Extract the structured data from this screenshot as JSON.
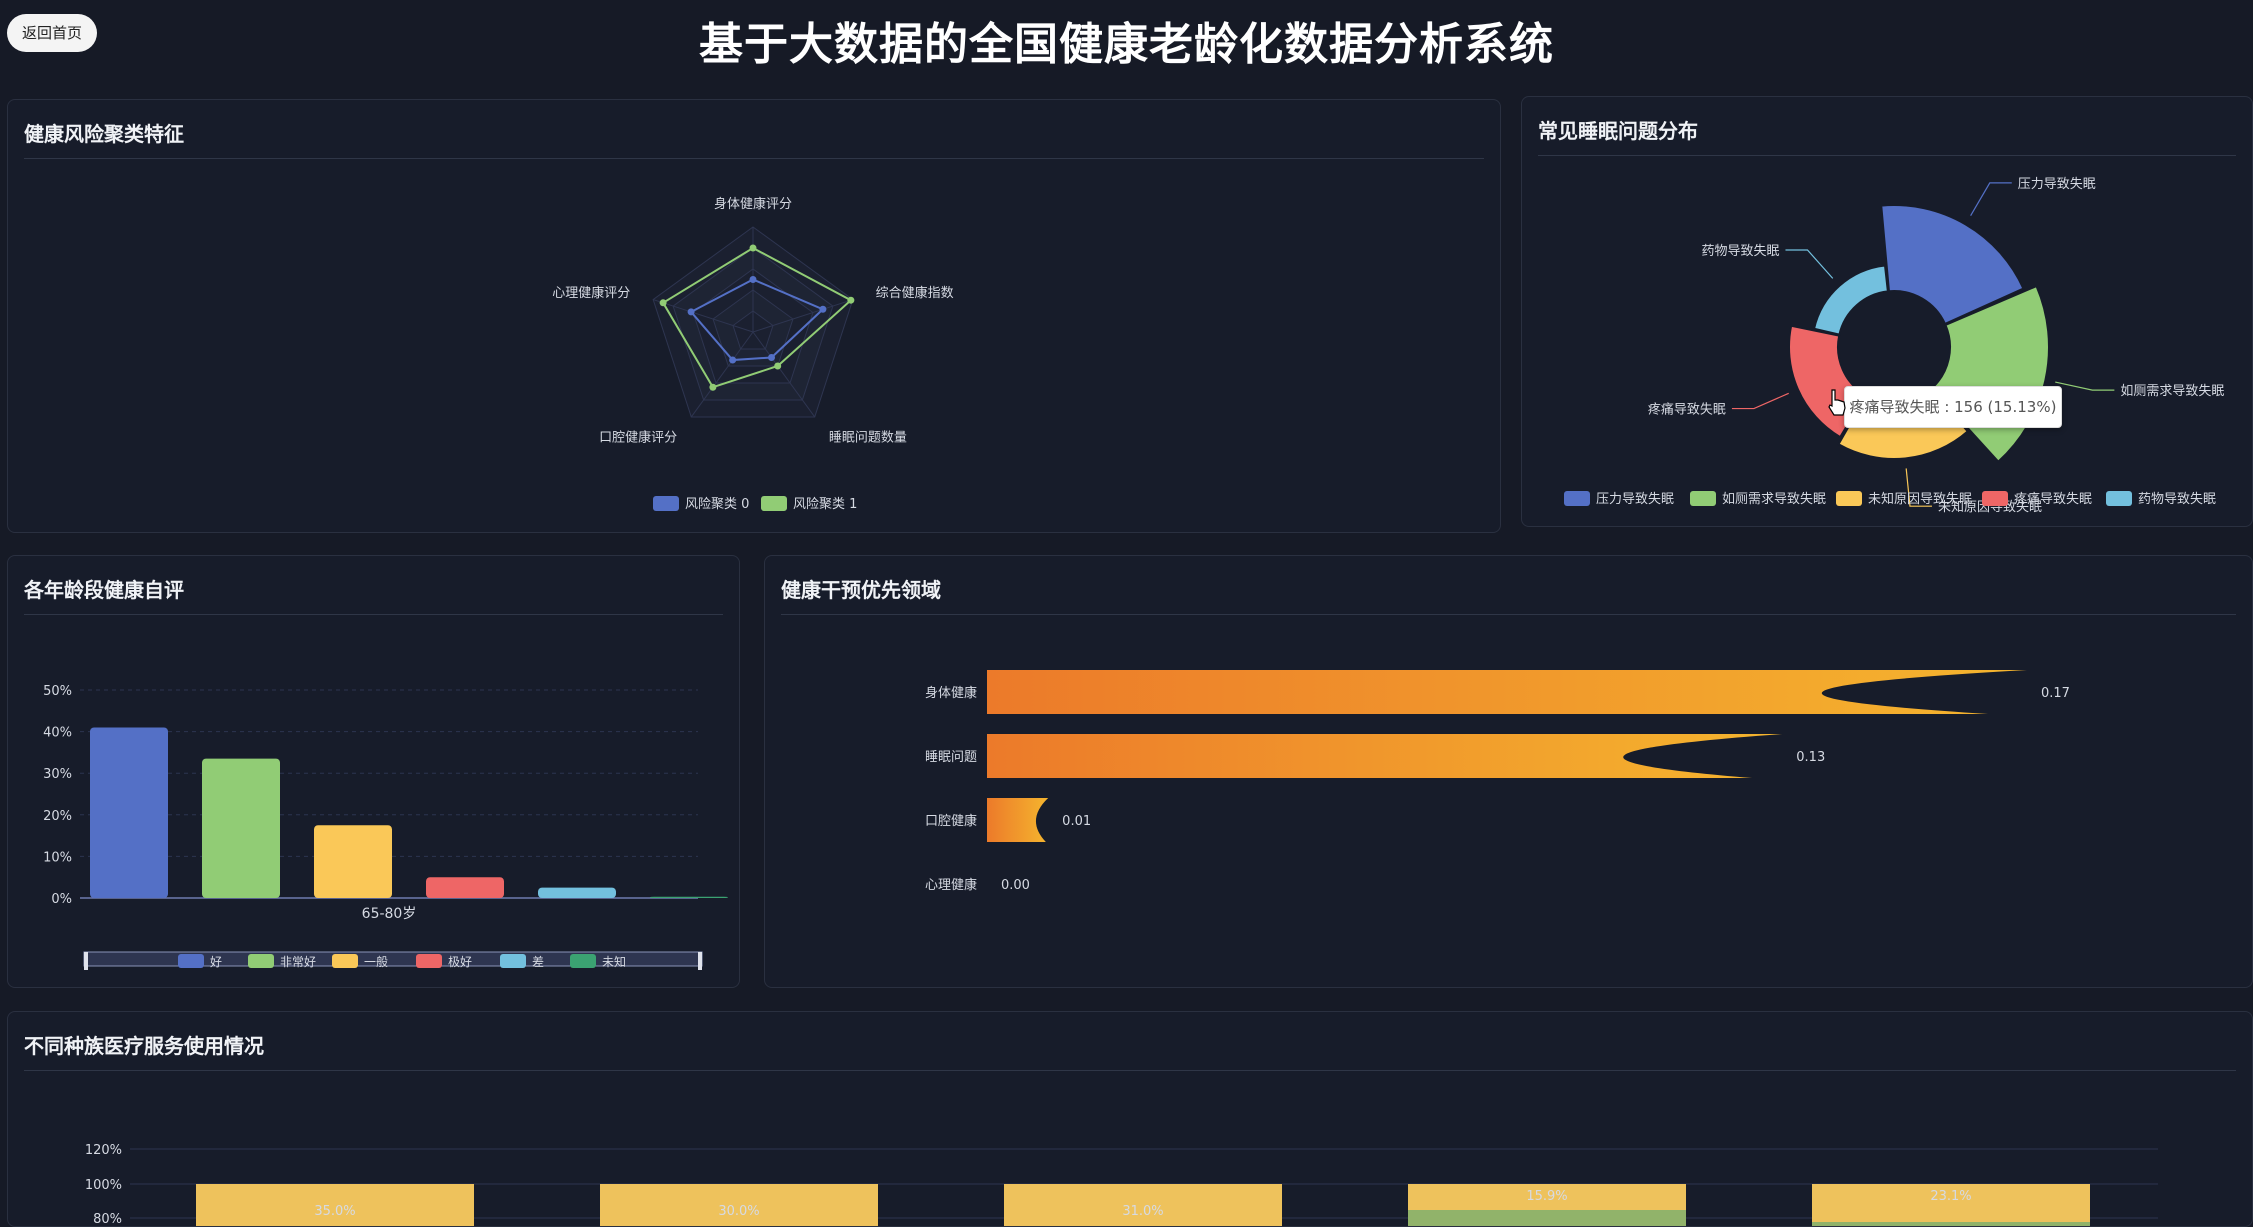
{
  "header": {
    "back_label": "返回首页",
    "title": "基于大数据的全国健康老龄化数据分析系统"
  },
  "panels": {
    "radar_title": "健康风险聚类特征",
    "sleep_title": "常见睡眠问题分布",
    "age_title": "各年龄段健康自评",
    "priority_title": "健康干预优先领域",
    "race_title": "不同种族医疗服务使用情况"
  },
  "tooltip": {
    "text": "疼痛导致失眠 : 156 (15.13%)"
  },
  "chart_data": [
    {
      "type": "radar",
      "indicators": [
        "身体健康评分",
        "综合健康指数",
        "睡眠问题数量",
        "口腔健康评分",
        "心理健康评分"
      ],
      "series": [
        {
          "name": "风险聚类 0",
          "values": [
            0.5,
            0.7,
            0.3,
            0.33,
            0.62
          ],
          "color": "#5470c6"
        },
        {
          "name": "风险聚类 1",
          "values": [
            0.8,
            0.98,
            0.4,
            0.65,
            0.9
          ],
          "color": "#91cc75"
        }
      ],
      "max": 1
    },
    {
      "type": "pie",
      "style": "rose",
      "slices": [
        {
          "name": "压力导致失眠",
          "color": "#5470c6"
        },
        {
          "name": "如厕需求导致失眠",
          "color": "#91cc75"
        },
        {
          "name": "未知原因导致失眠",
          "color": "#fac858"
        },
        {
          "name": "疼痛导致失眠",
          "value": 156,
          "percent": 15.13,
          "color": "#ee6666"
        },
        {
          "name": "药物导致失眠",
          "color": "#73c0de"
        }
      ]
    },
    {
      "type": "bar",
      "categories": [
        "65-80岁"
      ],
      "series": [
        {
          "name": "好",
          "values": [
            41
          ],
          "color": "#5470c6"
        },
        {
          "name": "非常好",
          "values": [
            33.5
          ],
          "color": "#91cc75"
        },
        {
          "name": "一般",
          "values": [
            17.5
          ],
          "color": "#fac858"
        },
        {
          "name": "极好",
          "values": [
            5
          ],
          "color": "#ee6666"
        },
        {
          "name": "差",
          "values": [
            2.5
          ],
          "color": "#73c0de"
        },
        {
          "name": "未知",
          "values": [
            0.3
          ],
          "color": "#3ba272"
        }
      ],
      "yticks": [
        "0%",
        "10%",
        "20%",
        "30%",
        "40%",
        "50%"
      ],
      "ylim": [
        0,
        50
      ]
    },
    {
      "type": "bar",
      "orientation": "horizontal",
      "categories": [
        "身体健康",
        "睡眠问题",
        "口腔健康",
        "心理健康"
      ],
      "values": [
        0.17,
        0.13,
        0.01,
        0.0
      ],
      "value_labels": [
        "0.17",
        "0.13",
        "0.01",
        "0.00"
      ],
      "xlim": [
        0,
        0.17
      ]
    },
    {
      "type": "bar",
      "stacked": true,
      "yticks": [
        "80%",
        "100%",
        "120%"
      ],
      "top_segment_labels": [
        "35.0%",
        "30.0%",
        "31.0%",
        "15.9%",
        "23.1%"
      ]
    }
  ]
}
